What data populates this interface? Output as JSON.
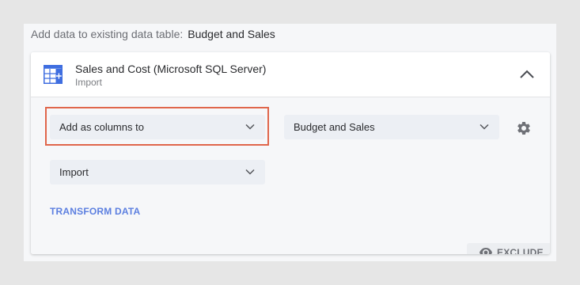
{
  "heading": {
    "prefix": "Add data to existing data table:",
    "table_name": "Budget and Sales"
  },
  "source": {
    "title": "Sales and Cost (Microsoft SQL Server)",
    "subtitle": "Import",
    "icon": "data-table-add-icon"
  },
  "options": {
    "add_mode": "Add as columns to",
    "target_table": "Budget and Sales",
    "load_method": "Import"
  },
  "transform_label": "TRANSFORM DATA",
  "exclude_label": "EXCLUDE",
  "colors": {
    "highlight": "#e0664b",
    "accent": "#5c7fe0",
    "icon_blue": "#3f6ee0"
  }
}
